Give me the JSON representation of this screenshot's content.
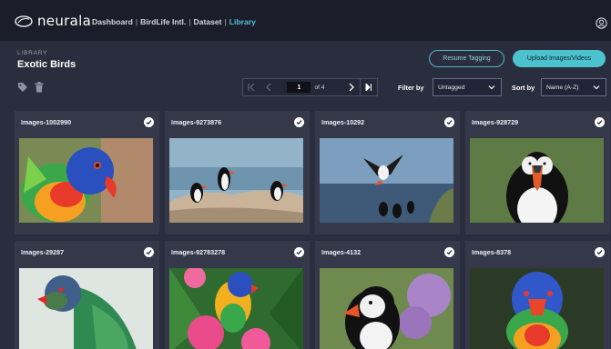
{
  "app": {
    "logo_text": "neurala",
    "breadcrumb": [
      "Dashboard",
      "BirdLife Intl.",
      "Dataset",
      "Library"
    ],
    "user_icon": "user-circle-icon"
  },
  "header": {
    "section_label": "LIBRARY",
    "title": "Exotic Birds",
    "resume_label": "Resume Tagging",
    "upload_label": "Upload Images/Videos"
  },
  "toolbar": {
    "tag_icon": "tag-icon",
    "trash_icon": "trash-icon",
    "pager": {
      "current_page": "1",
      "page_of": "of 4"
    },
    "filter_label": "Filter by",
    "filter_value": "Untagged",
    "sort_label": "Sort by",
    "sort_value": "Name (A-Z)"
  },
  "images": [
    {
      "name": "Images-1002990",
      "checked": true
    },
    {
      "name": "Images-9273876",
      "checked": true
    },
    {
      "name": "Images-10292",
      "checked": true
    },
    {
      "name": "Images-928729",
      "checked": true
    },
    {
      "name": "Images-29287",
      "checked": true
    },
    {
      "name": "Images-92783278",
      "checked": true
    },
    {
      "name": "Images-4132",
      "checked": true
    },
    {
      "name": "Images-8378",
      "checked": true
    }
  ],
  "colors": {
    "topbar": "#1b1d2a",
    "background": "#2a2d3e",
    "card": "#353849",
    "accent": "#4cc2cf",
    "active_crumb": "#4ec2d6"
  }
}
